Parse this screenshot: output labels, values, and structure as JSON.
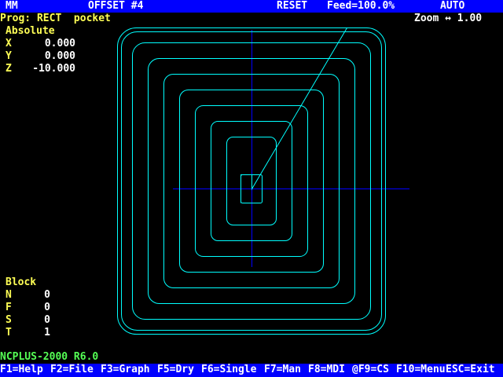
{
  "status_bar": {
    "units": "MM",
    "offset": "OFFSET #4",
    "state": "RESET",
    "feed": "Feed=100.0%",
    "mode": "AUTO"
  },
  "program": {
    "label": "Prog: RECT  pocket"
  },
  "zoom": {
    "label": "Zoom ↔ 1.00"
  },
  "absolute": {
    "heading": "Absolute",
    "axes": [
      {
        "name": "X",
        "value": "0.000"
      },
      {
        "name": "Y",
        "value": "0.000"
      },
      {
        "name": "Z",
        "value": "-10.000"
      }
    ]
  },
  "block": {
    "heading": "Block",
    "fields": [
      {
        "name": "N",
        "value": "0"
      },
      {
        "name": "F",
        "value": "0"
      },
      {
        "name": "S",
        "value": "0"
      },
      {
        "name": "T",
        "value": "1"
      }
    ]
  },
  "version": "NCPLUS-2000 R6.0",
  "function_keys": [
    {
      "label": "F1=Help"
    },
    {
      "label": "F2=File"
    },
    {
      "label": "F3=Graph"
    },
    {
      "label": "F5=Dry"
    },
    {
      "label": "F6=Single"
    },
    {
      "label": "F7=Man"
    },
    {
      "label": "F8=MDI"
    },
    {
      "label": "@F9=CS"
    },
    {
      "label": "F10=Menu"
    },
    {
      "label": "ESC=Exit"
    }
  ],
  "colors": {
    "toolpath": "#00ffff",
    "crosshair": "#0000ff",
    "bar_background": "#0000ff",
    "labels": "#ffff55",
    "version_text": "#55ff55"
  }
}
